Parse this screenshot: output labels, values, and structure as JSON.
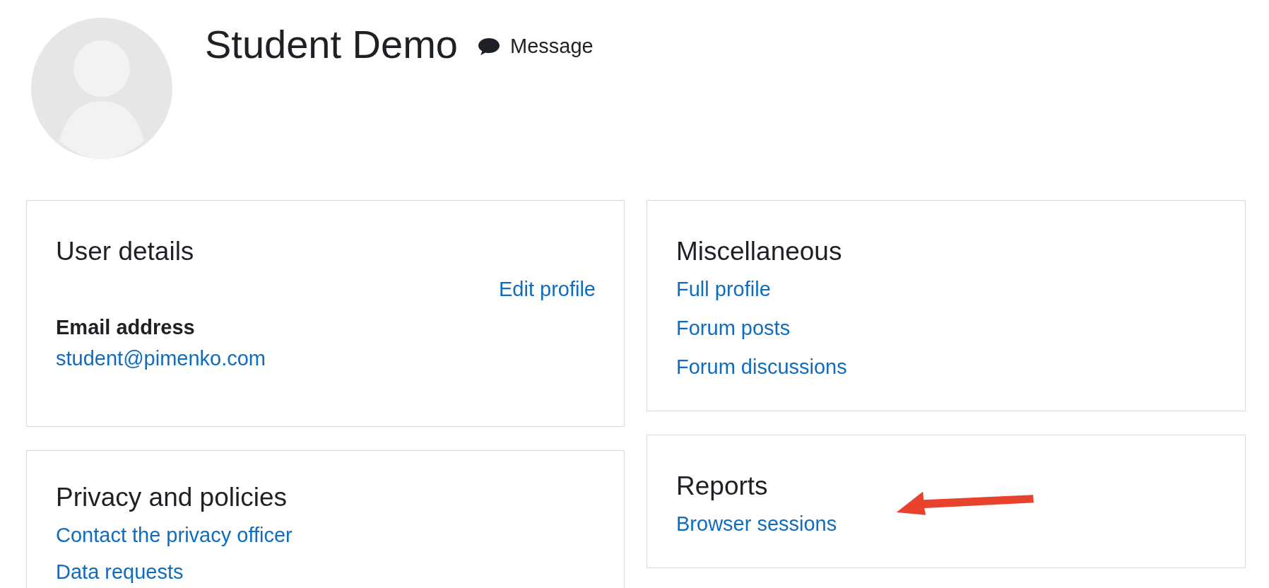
{
  "profile": {
    "name": "Student Demo",
    "message_label": "Message"
  },
  "left_column": [
    {
      "title": "User details",
      "edit_link": "Edit profile",
      "fields": [
        {
          "label": "Email address",
          "value": "student@pimenko.com"
        }
      ]
    },
    {
      "title": "Privacy and policies",
      "links": [
        "Contact the privacy officer",
        "Data requests"
      ]
    }
  ],
  "right_column": [
    {
      "title": "Miscellaneous",
      "links": [
        "Full profile",
        "Forum posts",
        "Forum discussions"
      ]
    },
    {
      "title": "Reports",
      "links": [
        "Browser sessions"
      ]
    }
  ]
}
